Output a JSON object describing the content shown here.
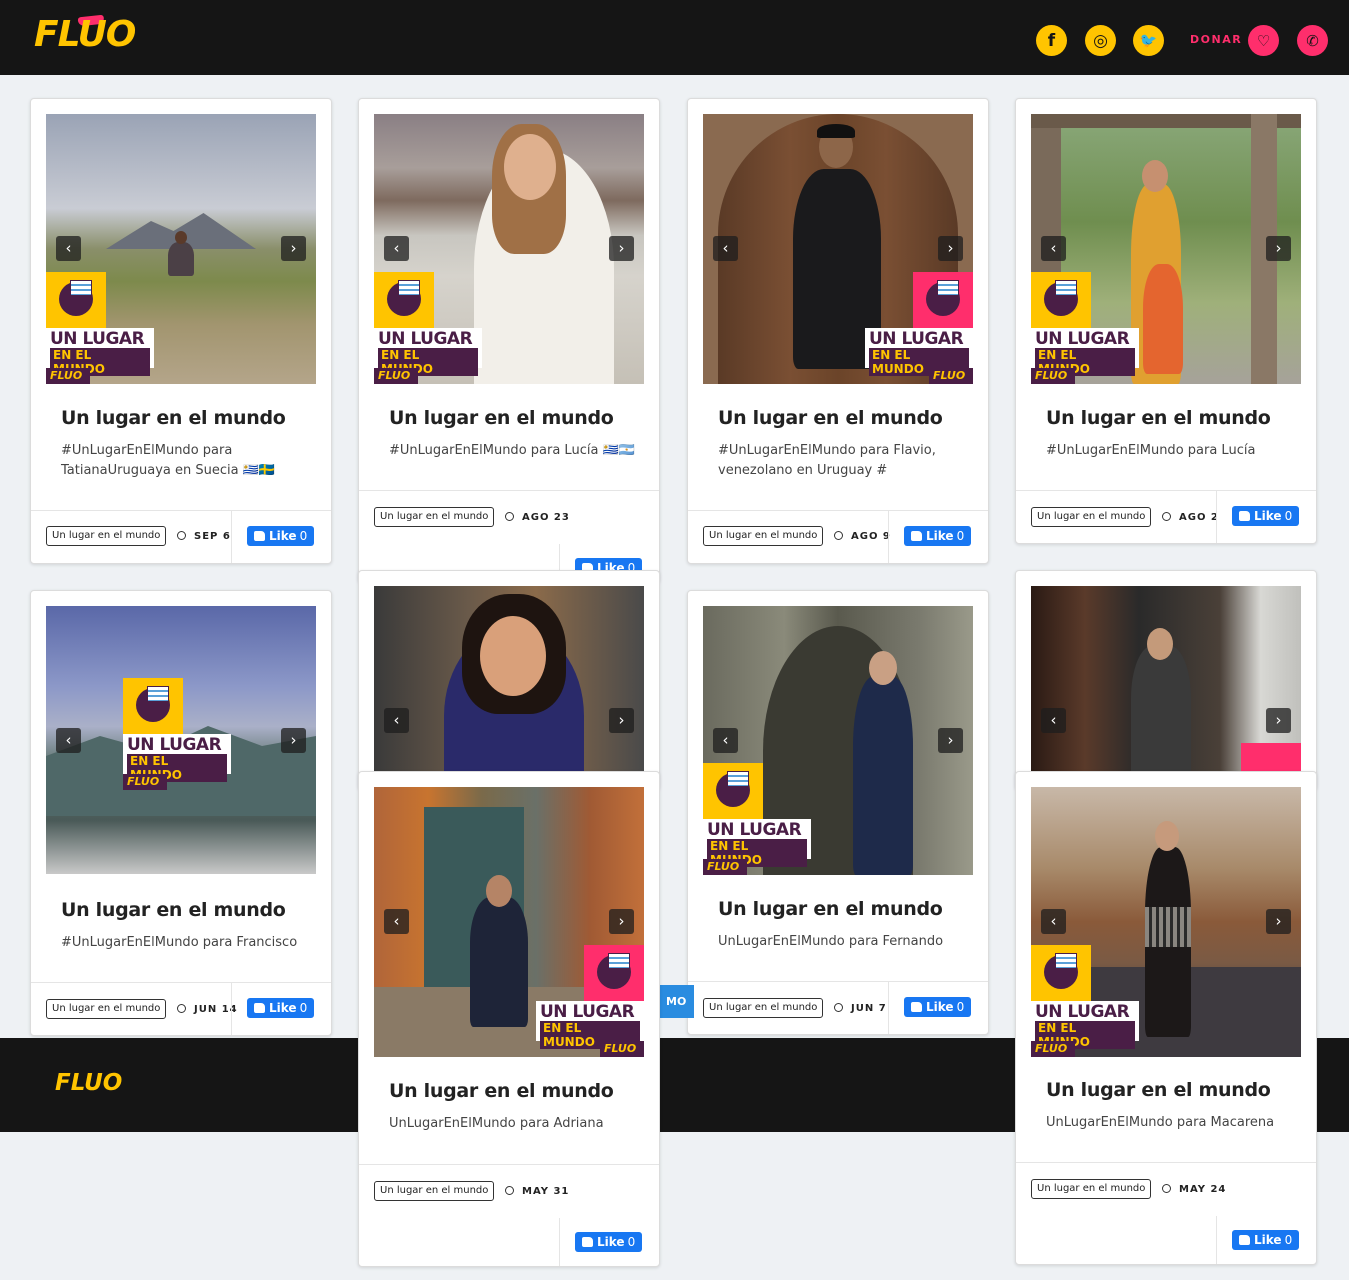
{
  "header": {
    "logo": "FLUO",
    "social": [
      {
        "icon": "facebook-icon",
        "glyph": "f"
      },
      {
        "icon": "instagram-icon",
        "glyph": "◎"
      },
      {
        "icon": "twitter-icon",
        "glyph": "🐦"
      }
    ],
    "donar_label": "DONAR",
    "donate_icon": "heart-hand-icon",
    "whatsapp_icon": "whatsapp-icon"
  },
  "cards": [
    {
      "title": "Un lugar en el mundo",
      "desc": "#UnLugarEnElMundo para TatianaUruguaya en Suecia 🇺🇾🇸🇪",
      "tag": "Un lugar en el mundo",
      "date": "SEP 6",
      "like": "Like",
      "like_count": "0"
    },
    {
      "title": "Un lugar en el mundo",
      "desc": "#UnLugarEnElMundo para Lucía 🇺🇾🇦🇷",
      "tag": "Un lugar en el mundo",
      "date": "AGO 23",
      "like": "Like",
      "like_count": "0"
    },
    {
      "title": "Un lugar en el mundo",
      "desc": "#UnLugarEnElMundo para Flavio, venezolano en Uruguay  #",
      "tag": "Un lugar en el mundo",
      "date": "AGO 9",
      "like": "Like",
      "like_count": "0"
    },
    {
      "title": "Un lugar en el mundo",
      "desc": "#UnLugarEnElMundo para Lucía",
      "tag": "Un lugar en el mundo",
      "date": "AGO 2",
      "like": "Like",
      "like_count": "0"
    },
    {
      "title": "Un lugar en el mundo",
      "desc": "#UnLugarEnElMundo para Francisco",
      "tag": "Un lugar en el mundo",
      "date": "JUN 14",
      "like": "Like",
      "like_count": "0"
    },
    {
      "title": "Un lugar en el mundo",
      "desc": "UnLugarEnElMundo para Fernando",
      "tag": "Un lugar en el mundo",
      "date": "JUN 7",
      "like": "Like",
      "like_count": "0"
    },
    {
      "title": "Un lugar en el mundo",
      "desc": "UnLugarEnElMundo para Adriana",
      "tag": "Un lugar en el mundo",
      "date": "MAY 31",
      "like": "Like",
      "like_count": "0"
    },
    {
      "title": "Un lugar en el mundo",
      "desc": "UnLugarEnElMundo para Macarena",
      "tag": "Un lugar en el mundo",
      "date": "MAY 24",
      "like": "Like",
      "like_count": "0"
    }
  ],
  "badge": {
    "line1": "UN LUGAR",
    "line2": "EN EL MUNDO",
    "brand": "FLUO"
  },
  "load_more": "MO",
  "footer": {
    "logo": "FLUO"
  },
  "colors": {
    "brand_yellow": "#ffc400",
    "brand_pink": "#ff2e6c",
    "brand_purple": "#4a1e46",
    "facebook_blue": "#1877f2"
  }
}
